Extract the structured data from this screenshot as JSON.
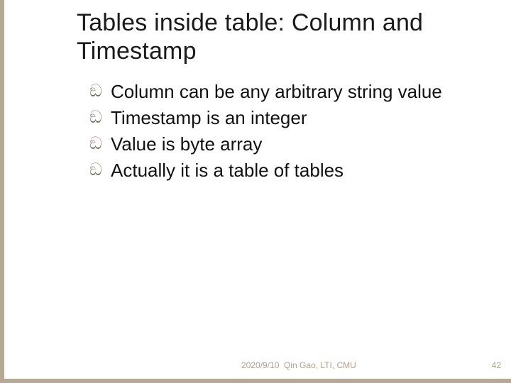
{
  "title": "Tables inside table: Column and Timestamp",
  "bullets": [
    "Column can be any arbitrary string value",
    "Timestamp is an integer",
    "Value is byte array",
    "Actually it is a table of tables"
  ],
  "bullet_glyph": "ඞ",
  "footer": {
    "date": "2020/9/10",
    "author": "Qin Gao, LTI, CMU",
    "page": "42"
  }
}
